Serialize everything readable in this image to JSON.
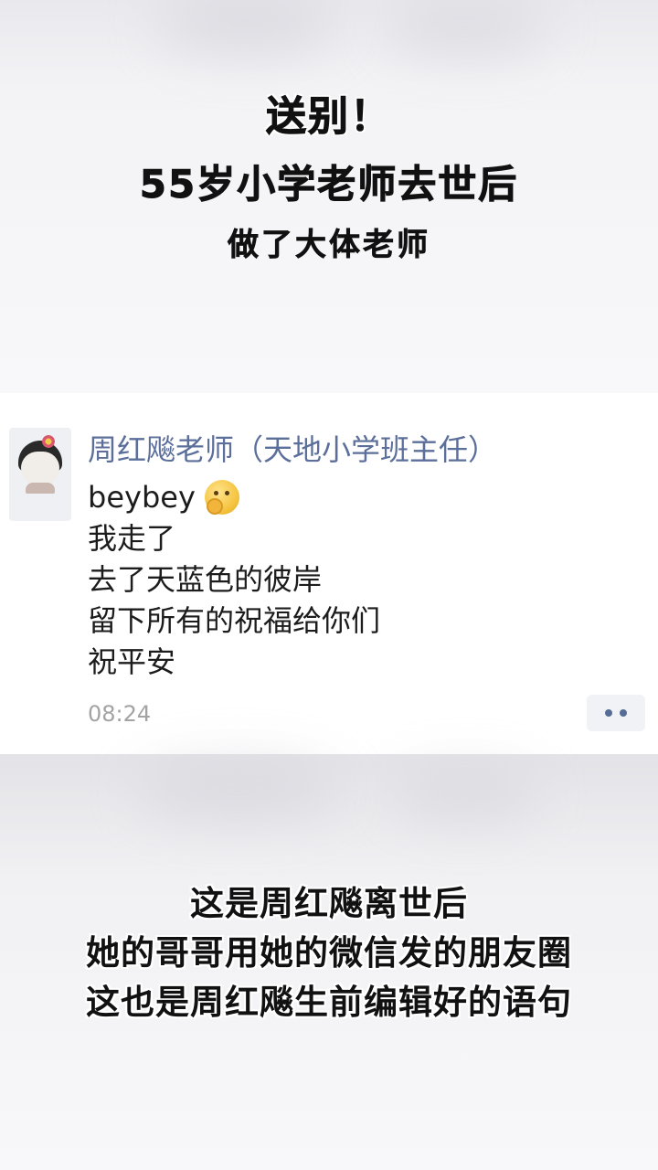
{
  "headline": {
    "line1": "送别！",
    "line2": "55岁小学老师去世后",
    "line3": "做了大体老师"
  },
  "post": {
    "username": "周红飚老师（天地小学班主任）",
    "lines": [
      "beybey",
      "我走了",
      "去了天蓝色的彼岸",
      "留下所有的祝福给你们",
      "祝平安"
    ],
    "emoji": "shush-emoji",
    "timestamp": "08:24"
  },
  "subtitles": [
    "这是周红飚离世后",
    "她的哥哥用她的微信发的朋友圈",
    "这也是周红飚生前编辑好的语句"
  ],
  "colors": {
    "username": "#5c6f9a",
    "timestamp": "#a3a3a3",
    "more_button_bg": "#f0f2f6",
    "more_button_dots": "#566b95"
  }
}
